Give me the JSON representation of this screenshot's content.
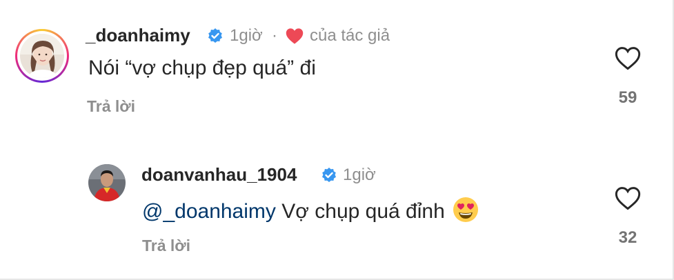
{
  "comments": [
    {
      "username": "_doanhaimy",
      "time": "1giờ",
      "separator": "·",
      "author_like_label": "của tác giả",
      "text": "Nói “vợ chụp đẹp quá” đi",
      "reply_label": "Trả lời",
      "likes": "59"
    },
    {
      "username": "doanvanhau_1904",
      "time": "1giờ",
      "mention": "@_doanhaimy",
      "text": " Vợ chụp quá đỉnh",
      "reply_label": "Trả lời",
      "likes": "32",
      "emoji": "heart-eyes-emoji"
    }
  ],
  "colors": {
    "verified": "#3897f0",
    "author_heart": "#ed4956",
    "mention": "#00376b",
    "secondary_text": "#8e8e8e"
  }
}
